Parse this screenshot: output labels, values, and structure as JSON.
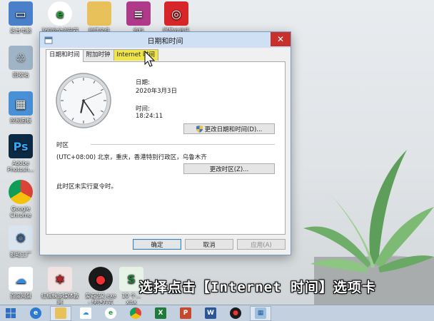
{
  "desktop": {
    "icons": [
      {
        "label": "这台电脑"
      },
      {
        "label": "360安全浏览器"
      },
      {
        "label": "新建文件"
      },
      {
        "label": "资料"
      },
      {
        "label": "网易云音乐"
      },
      {
        "label": "回收站"
      },
      {
        "label": "控制面板"
      },
      {
        "label": "Adobe\nPhotosh..."
      },
      {
        "label": "Google\nChrome"
      },
      {
        "label": "驱动工厂"
      },
      {
        "label": "百度网盘"
      },
      {
        "label": "红蜘蛛多媒体教\n网"
      },
      {
        "label": "爱奇艺2.exe\n- 快捷方式"
      },
      {
        "label": "10 个...\nxlsx"
      }
    ]
  },
  "dialog": {
    "title": "日期和时间",
    "close_glyph": "✕",
    "tabs": [
      {
        "label": "日期和时间"
      },
      {
        "label": "附加时钟"
      },
      {
        "label": "Internet 时间"
      }
    ],
    "date_label": "日期:",
    "date_value": "2020年3月3日",
    "time_label": "时间:",
    "time_value": "18:24:11",
    "change_datetime_button": "更改日期和时间(D)...",
    "timezone_section_label": "时区",
    "timezone_value": "(UTC+08:00) 北京，重庆，香港特别行政区，乌鲁木齐",
    "change_timezone_button": "更改时区(Z)...",
    "dst_note": "此时区未实行夏令时。",
    "ok_button": "确定",
    "cancel_button": "取消",
    "apply_button": "应用(A)"
  },
  "clock": {
    "hours": 18,
    "minutes": 24,
    "seconds": 11
  },
  "subtitle": "选择点击【Internet 时间】选项卡",
  "colors": {
    "tab_highlight": "#f0e64a",
    "close_button": "#c7302b",
    "title_bar": "#cfe0f4"
  },
  "taskbar": {
    "items": [
      {
        "icon": "windows-start-icon"
      },
      {
        "icon": "ie-browser-icon"
      },
      {
        "icon": "file-explorer-icon"
      },
      {
        "icon": "baidu-netdisk-icon"
      },
      {
        "icon": "360-browser-icon"
      },
      {
        "icon": "chrome-icon"
      },
      {
        "icon": "excel-icon",
        "text": "X"
      },
      {
        "icon": "powerpoint-icon",
        "text": "P"
      },
      {
        "icon": "word-icon",
        "text": "W"
      },
      {
        "icon": "netease-music-icon"
      },
      {
        "icon": "network-icon"
      }
    ]
  }
}
